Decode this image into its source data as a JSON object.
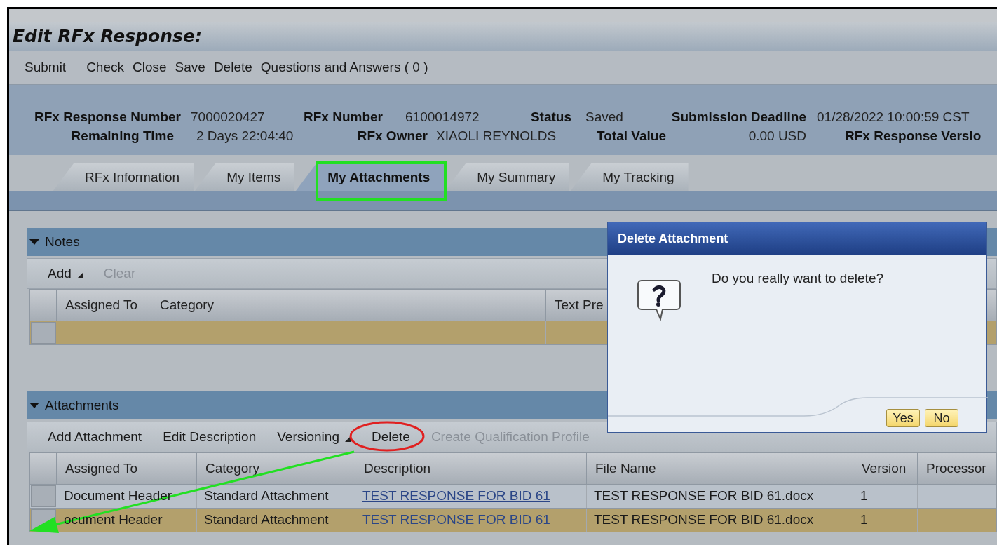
{
  "window": {
    "title": "Edit RFx Response:"
  },
  "toolbar": [
    {
      "kind": "button",
      "label": "Submit"
    },
    {
      "kind": "separator"
    },
    {
      "kind": "button",
      "label": "Check"
    },
    {
      "kind": "button",
      "label": "Close"
    },
    {
      "kind": "button",
      "label": "Save"
    },
    {
      "kind": "button",
      "label": "Delete"
    },
    {
      "kind": "button",
      "label": "Questions and Answers ( 0 )"
    }
  ],
  "header": {
    "rows": [
      [
        {
          "label": "RFx Response Number",
          "value": "7000020427"
        },
        {
          "label": "RFx Number",
          "value": "6100014972"
        },
        {
          "label": "Status",
          "value": "Saved"
        },
        {
          "label": "Submission Deadline",
          "value": "01/28/2022 10:00:59 CST"
        }
      ],
      [
        {
          "label": "Remaining Time",
          "value": "2 Days 22:04:40"
        },
        {
          "label": "RFx Owner",
          "value": "XIAOLI REYNOLDS"
        },
        {
          "label": "Total Value",
          "value": "0.00 USD"
        },
        {
          "label": "RFx Response Versio"
        }
      ]
    ]
  },
  "tabs": [
    {
      "label": "RFx Information",
      "selected": false
    },
    {
      "label": "My Items",
      "selected": false
    },
    {
      "label": "My Attachments",
      "selected": true
    },
    {
      "label": "My Summary",
      "selected": false
    },
    {
      "label": "My Tracking",
      "selected": false
    }
  ],
  "notes": {
    "title": "Notes",
    "expanded": true,
    "toolbar": [
      {
        "kind": "menu",
        "label": "Add",
        "disabled": false
      },
      {
        "kind": "button",
        "label": "Clear",
        "disabled": true
      }
    ],
    "columns": [
      "Assigned To",
      "Category",
      "Text Pre"
    ],
    "rows": [
      {
        "selected": true
      }
    ]
  },
  "attachments": {
    "title": "Attachments",
    "expanded": true,
    "toolbar": [
      {
        "kind": "button",
        "label": "Add Attachment",
        "disabled": false
      },
      {
        "kind": "button",
        "label": "Edit Description",
        "disabled": false
      },
      {
        "kind": "menu",
        "label": "Versioning",
        "disabled": false
      },
      {
        "kind": "button",
        "label": "Delete",
        "disabled": false
      },
      {
        "kind": "button",
        "label": "Create Qualification Profile",
        "disabled": true
      }
    ],
    "columns": [
      "Assigned To",
      "Category",
      "Description",
      "File Name",
      "Version",
      "Processor"
    ],
    "rows": [
      {
        "selected": false,
        "cells": [
          {
            "kind": "text",
            "text": "Document Header"
          },
          {
            "kind": "text",
            "text": "Standard Attachment"
          },
          {
            "kind": "link",
            "text": "TEST RESPONSE FOR BID 61"
          },
          {
            "kind": "text",
            "text": "TEST RESPONSE FOR BID 61.docx"
          },
          {
            "kind": "text",
            "text": "1"
          }
        ]
      },
      {
        "selected": true,
        "cells": [
          {
            "kind": "text",
            "text": "ocument Header"
          },
          {
            "kind": "text",
            "text": "Standard Attachment"
          },
          {
            "kind": "link",
            "text": "TEST RESPONSE FOR BID 61"
          },
          {
            "kind": "text",
            "text": "TEST RESPONSE FOR BID 61.docx"
          },
          {
            "kind": "text",
            "text": "1"
          }
        ]
      }
    ]
  },
  "dialog": {
    "title": "Delete Attachment",
    "message": "Do you really want to delete?",
    "buttons": [
      "Yes",
      "No"
    ]
  },
  "annotations": [
    {
      "kind": "box",
      "color": "#22e022"
    },
    {
      "kind": "ellipse",
      "color": "#e02020"
    },
    {
      "kind": "arrow",
      "color": "#22e022"
    }
  ]
}
